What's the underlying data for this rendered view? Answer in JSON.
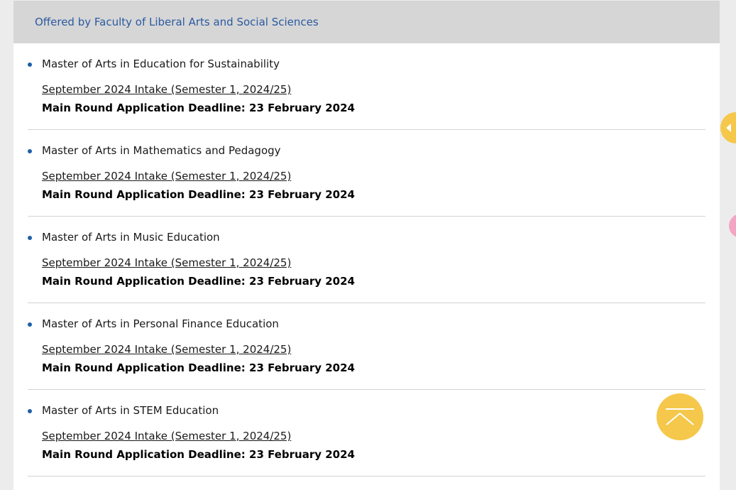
{
  "section": {
    "heading": "Offered by Faculty of Liberal Arts and Social Sciences"
  },
  "programmes": [
    {
      "title": "Master of Arts in Education for Sustainability",
      "intake": "September 2024 Intake (Semester 1, 2024/25)",
      "deadline": "Main Round Application Deadline: 23 February 2024"
    },
    {
      "title": "Master of Arts in Mathematics and Pedagogy",
      "intake": "September 2024 Intake (Semester 1, 2024/25)",
      "deadline": "Main Round Application Deadline: 23 February 2024"
    },
    {
      "title": "Master of Arts in Music Education",
      "intake": "September 2024 Intake (Semester 1, 2024/25)",
      "deadline": "Main Round Application Deadline: 23 February 2024"
    },
    {
      "title": "Master of Arts in Personal Finance Education",
      "intake": "September 2024 Intake (Semester 1, 2024/25)",
      "deadline": "Main Round Application Deadline: 23 February 2024"
    },
    {
      "title": "Master of Arts in STEM Education",
      "intake": "September 2024 Intake (Semester 1, 2024/25)",
      "deadline": "Main Round Application Deadline: 23 February 2024"
    }
  ],
  "icons": {
    "back_to_top": "chevron-up-icon",
    "side_tab_yellow": "chevron-left-icon"
  },
  "colors": {
    "heading": "#2b5aa0",
    "header_bg": "#d6d6d6",
    "accent_yellow": "#f5c84b",
    "accent_pink": "#f2a6c4",
    "bullet": "#1f5fa8"
  }
}
